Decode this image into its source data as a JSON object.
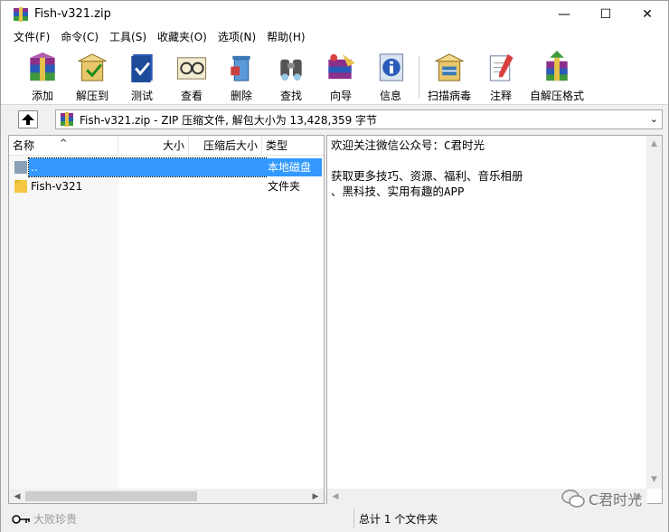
{
  "window": {
    "title": "Fish-v321.zip",
    "minimize": "—",
    "maximize": "☐",
    "close": "✕"
  },
  "menu": [
    "文件(F)",
    "命令(C)",
    "工具(S)",
    "收藏夹(O)",
    "选项(N)",
    "帮助(H)"
  ],
  "toolbar": [
    {
      "label": "添加",
      "icon": "add-archive-icon"
    },
    {
      "label": "解压到",
      "icon": "extract-to-icon"
    },
    {
      "label": "测试",
      "icon": "test-icon"
    },
    {
      "label": "查看",
      "icon": "view-icon"
    },
    {
      "label": "删除",
      "icon": "delete-icon"
    },
    {
      "label": "查找",
      "icon": "find-icon"
    },
    {
      "label": "向导",
      "icon": "wizard-icon"
    },
    {
      "label": "信息",
      "icon": "info-icon"
    },
    {
      "label": "扫描病毒",
      "icon": "virus-scan-icon"
    },
    {
      "label": "注释",
      "icon": "comment-icon"
    },
    {
      "label": "自解压格式",
      "icon": "sfx-icon"
    }
  ],
  "address": {
    "text": "Fish-v321.zip - ZIP 压缩文件, 解包大小为 13,428,359 字节"
  },
  "file_list": {
    "columns": [
      "名称",
      "大小",
      "压缩后大小",
      "类型"
    ],
    "rows": [
      {
        "name": "..",
        "type": "本地磁盘",
        "selected": true,
        "icon": "parent-folder-icon"
      },
      {
        "name": "Fish-v321",
        "type": "文件夹",
        "selected": false,
        "icon": "folder-icon"
      }
    ]
  },
  "comment": {
    "text": "欢迎关注微信公众号：C君时光\n\n获取更多技巧、资源、福利、音乐相册\n、黑科技、实用有趣的APP"
  },
  "status": {
    "left": "大败珍贵",
    "right": "总计 1 个文件夹"
  },
  "watermark": "C君时光",
  "colors": {
    "selection": "#3399ff",
    "folder": "#f5c842"
  }
}
